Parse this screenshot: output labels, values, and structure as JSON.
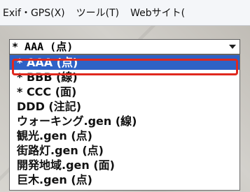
{
  "menubar": {
    "items": [
      "Exif・GPS(X)",
      "ツール(T)",
      "Webサイト("
    ]
  },
  "combo": {
    "value": "* AAA (点)"
  },
  "dropdown": {
    "items": [
      {
        "label": "* AAA (点)",
        "selected": true
      },
      {
        "label": "* BBB (線)",
        "selected": false
      },
      {
        "label": "* CCC (面)",
        "selected": false
      },
      {
        "label": "DDD (注記)",
        "selected": false
      },
      {
        "label": "ウォーキング.gen (線)",
        "selected": false
      },
      {
        "label": "観光.gen (点)",
        "selected": false
      },
      {
        "label": "街路灯.gen (点)",
        "selected": false
      },
      {
        "label": "開発地域.gen (面)",
        "selected": false
      },
      {
        "label": "巨木.gen (点)",
        "selected": false
      }
    ]
  },
  "colors": {
    "selection": "#2e62c6",
    "highlight_border": "#e0281e"
  }
}
